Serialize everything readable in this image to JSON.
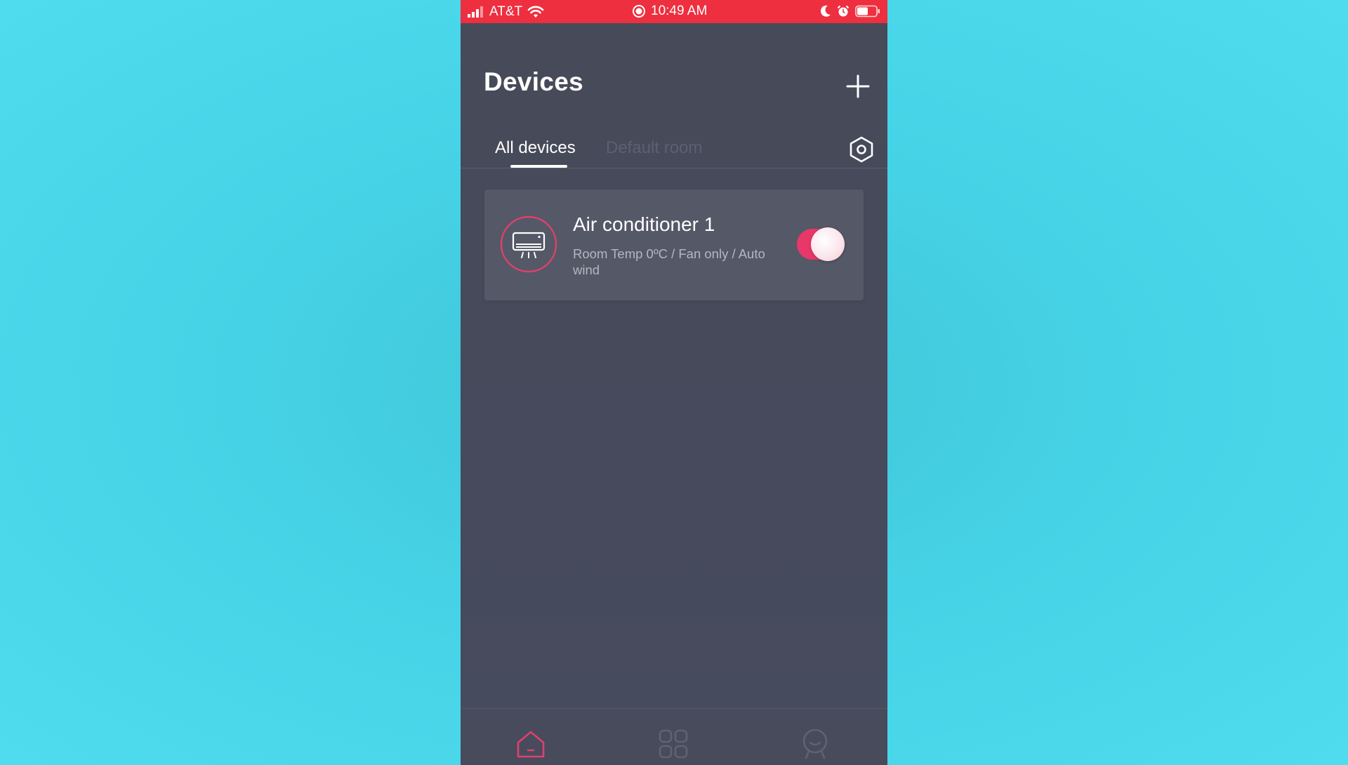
{
  "status_bar": {
    "carrier": "AT&T",
    "time": "10:49 AM"
  },
  "header": {
    "title": "Devices"
  },
  "tabs": [
    {
      "label": "All devices",
      "active": true
    },
    {
      "label": "Default room",
      "active": false
    }
  ],
  "devices": [
    {
      "name": "Air conditioner 1",
      "status": "Room Temp 0ºC / Fan only / Auto wind",
      "icon": "air-conditioner-icon",
      "power_on": true
    }
  ],
  "bottom_nav": {
    "items": [
      {
        "icon": "home-icon",
        "active": true
      },
      {
        "icon": "grid-icon",
        "active": false
      },
      {
        "icon": "profile-icon",
        "active": false
      }
    ]
  },
  "colors": {
    "status_bar": "#ee2f3f",
    "accent": "#e8386a",
    "background": "#474b5c",
    "card": "#555866",
    "outer_background": "#4fdcee"
  }
}
